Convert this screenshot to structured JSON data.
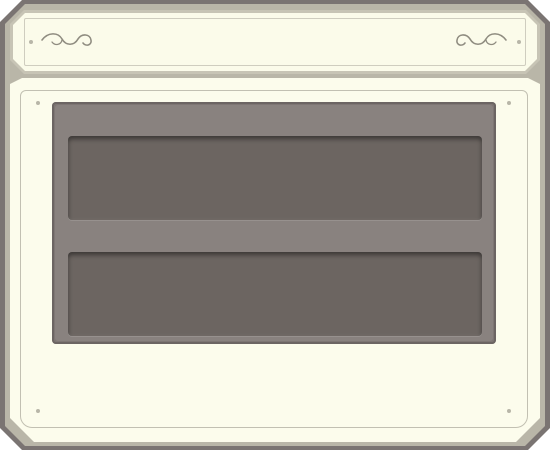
{
  "colors": {
    "frame_outer": "#7a7472",
    "frame_inner": "#b9b6a8",
    "parchment": "#fbfbea",
    "panel": "#89827f",
    "slot": "#6c6561"
  },
  "icons": {
    "left_flourish": "scroll-flourish-icon",
    "right_flourish": "scroll-flourish-icon"
  },
  "slots": [
    {
      "label": ""
    },
    {
      "label": ""
    }
  ]
}
